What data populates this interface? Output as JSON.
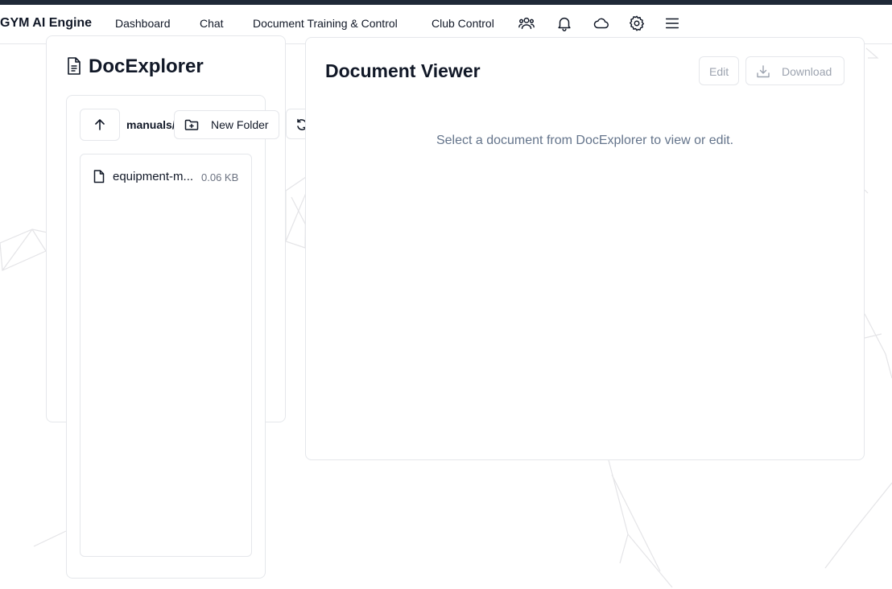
{
  "navbar": {
    "brand": "GYM AI Engine",
    "links": [
      "Dashboard",
      "Chat",
      "Document Training & Control",
      "Club Control"
    ],
    "icons": [
      "users-icon",
      "bell-icon",
      "cloud-icon",
      "gear-icon",
      "menu-icon"
    ]
  },
  "explorer": {
    "title": "DocExplorer",
    "current_path": "manuals/",
    "new_folder_label": "New Folder",
    "files": [
      {
        "name": "equipment-m...",
        "size": "0.06 KB"
      }
    ]
  },
  "viewer": {
    "title": "Document Viewer",
    "edit_label": "Edit",
    "download_label": "Download",
    "empty_message": "Select a document from DocExplorer to view or edit."
  },
  "colors": {
    "text": "#111827",
    "muted": "#64748b",
    "border": "#e5e7eb",
    "disabled": "#9ca3af",
    "top_strip": "#1f2937"
  }
}
